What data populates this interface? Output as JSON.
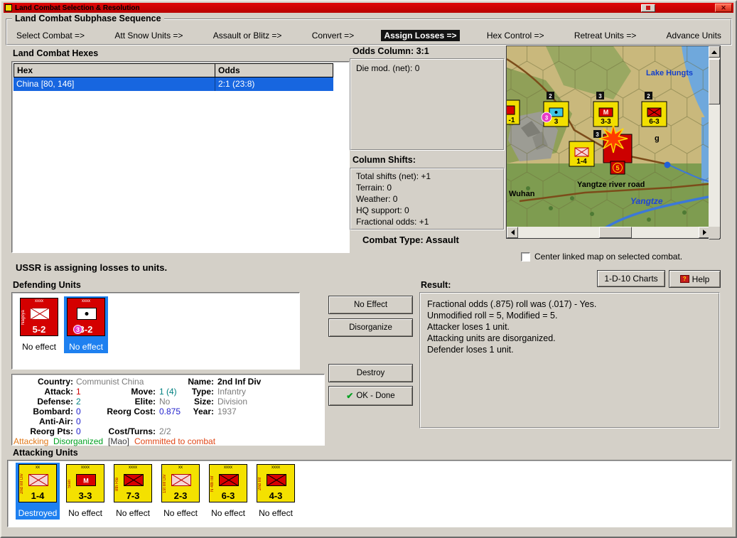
{
  "window": {
    "title": "Land Combat Selection & Resolution",
    "icons": {
      "close": "✕"
    }
  },
  "sequence": {
    "title": "Land Combat Subphase Sequence",
    "steps": [
      "Select Combat =>",
      "Att Snow Units =>",
      "Assault or Blitz =>",
      "Convert =>",
      "Assign Losses =>",
      "Hex Control =>",
      "Retreat Units =>",
      "Advance Units"
    ]
  },
  "hexes": {
    "title": "Land Combat Hexes",
    "columns": {
      "hex": "Hex",
      "odds": "Odds"
    },
    "rows": [
      {
        "hex": "China [80, 146]",
        "odds": "2:1 (23:8)"
      }
    ]
  },
  "odds": {
    "title": "Odds Column: 3:1",
    "die_mod": "Die mod. (net): 0"
  },
  "shifts": {
    "title": "Column Shifts:",
    "lines": [
      "Total shifts (net): +1",
      "Terrain: 0",
      "Weather: 0",
      "HQ support: 0",
      "Fractional odds: +1"
    ]
  },
  "combat_type": "Combat Type: Assault",
  "map": {
    "checkbox_label": "Center linked map on selected combat.",
    "labels": {
      "lake": "Lake Hungts",
      "city": "Wuhan",
      "road": "Yangtze river road",
      "river": "Yangtze",
      "partial": "g"
    },
    "units": [
      {
        "strength": "-1"
      },
      {
        "top": "2",
        "strength": "3",
        "badge": "3"
      },
      {
        "top": "3",
        "strength": "3-3",
        "symbol": "M"
      },
      {
        "top": "2",
        "strength": "6-3"
      },
      {
        "strength": "1-4"
      },
      {
        "top": "3",
        "strength": "5"
      }
    ]
  },
  "status_line": "USSR is assigning losses to units.",
  "buttons": {
    "charts": "1-D-10 Charts",
    "help": "Help",
    "help_icon": "?",
    "no_effect": "No Effect",
    "disorganize": "Disorganize",
    "destroy": "Destroy",
    "ok_done": "OK - Done",
    "check_icon": "✔"
  },
  "defending": {
    "title": "Defending Units",
    "units": [
      {
        "size": "xxxx",
        "name": "Nagoya",
        "strength": "5-2",
        "status": "No effect"
      },
      {
        "size": "xxxx",
        "name": "",
        "strength": "3-2",
        "status": "No effect",
        "badge": "3"
      }
    ]
  },
  "result": {
    "title": "Result:",
    "lines": [
      "Fractional odds (.875) roll was (.017)  - Yes.",
      "Unmodified roll = 5, Modified = 5.",
      "Attacker loses 1 unit.",
      "Attacking units are disorganized.",
      "Defender loses 1 unit."
    ]
  },
  "details": {
    "country_label": "Country:",
    "country": "Communist China",
    "name_label": "Name:",
    "name": "2nd Inf Div",
    "attack_label": "Attack:",
    "attack": "1",
    "move_label": "Move:",
    "move": "1 (4)",
    "type_label": "Type:",
    "type": "Infantry",
    "defense_label": "Defense:",
    "defense": "2",
    "elite_label": "Elite:",
    "elite": "No",
    "size_label": "Size:",
    "size": "Division",
    "bombard_label": "Bombard:",
    "bombard": "0",
    "reorg_cost_label": "Reorg Cost:",
    "reorg_cost": "0.875",
    "year_label": "Year:",
    "year": "1937",
    "antiair_label": "Anti-Air:",
    "antiair": "0",
    "reorg_pts_label": "Reorg Pts:",
    "reorg_pts": "0",
    "cost_turns_label": "Cost/Turns:",
    "cost_turns": "2/2",
    "flags": {
      "attacking": "Attacking",
      "disorganized": "Disorganized",
      "mao": "[Mao]",
      "committed": "Committed to combat"
    }
  },
  "attacking": {
    "title": "Attacking Units",
    "units": [
      {
        "size": "xx",
        "name": "2nd Inf Div",
        "strength": "1-4",
        "status": "Destroyed"
      },
      {
        "size": "xxxx",
        "name": "Sian",
        "strength": "3-3",
        "status": "No effect",
        "symbol": "M"
      },
      {
        "size": "xxxx",
        "name": "8th Rte",
        "strength": "7-3",
        "status": "No effect"
      },
      {
        "size": "xx",
        "name": "1st Inf Div",
        "strength": "2-3",
        "status": "No effect"
      },
      {
        "size": "xxxx",
        "name": "N 4th Inf",
        "strength": "6-3",
        "status": "No effect"
      },
      {
        "size": "xxxx",
        "name": "2nd Inf",
        "strength": "4-3",
        "status": "No effect"
      }
    ]
  }
}
